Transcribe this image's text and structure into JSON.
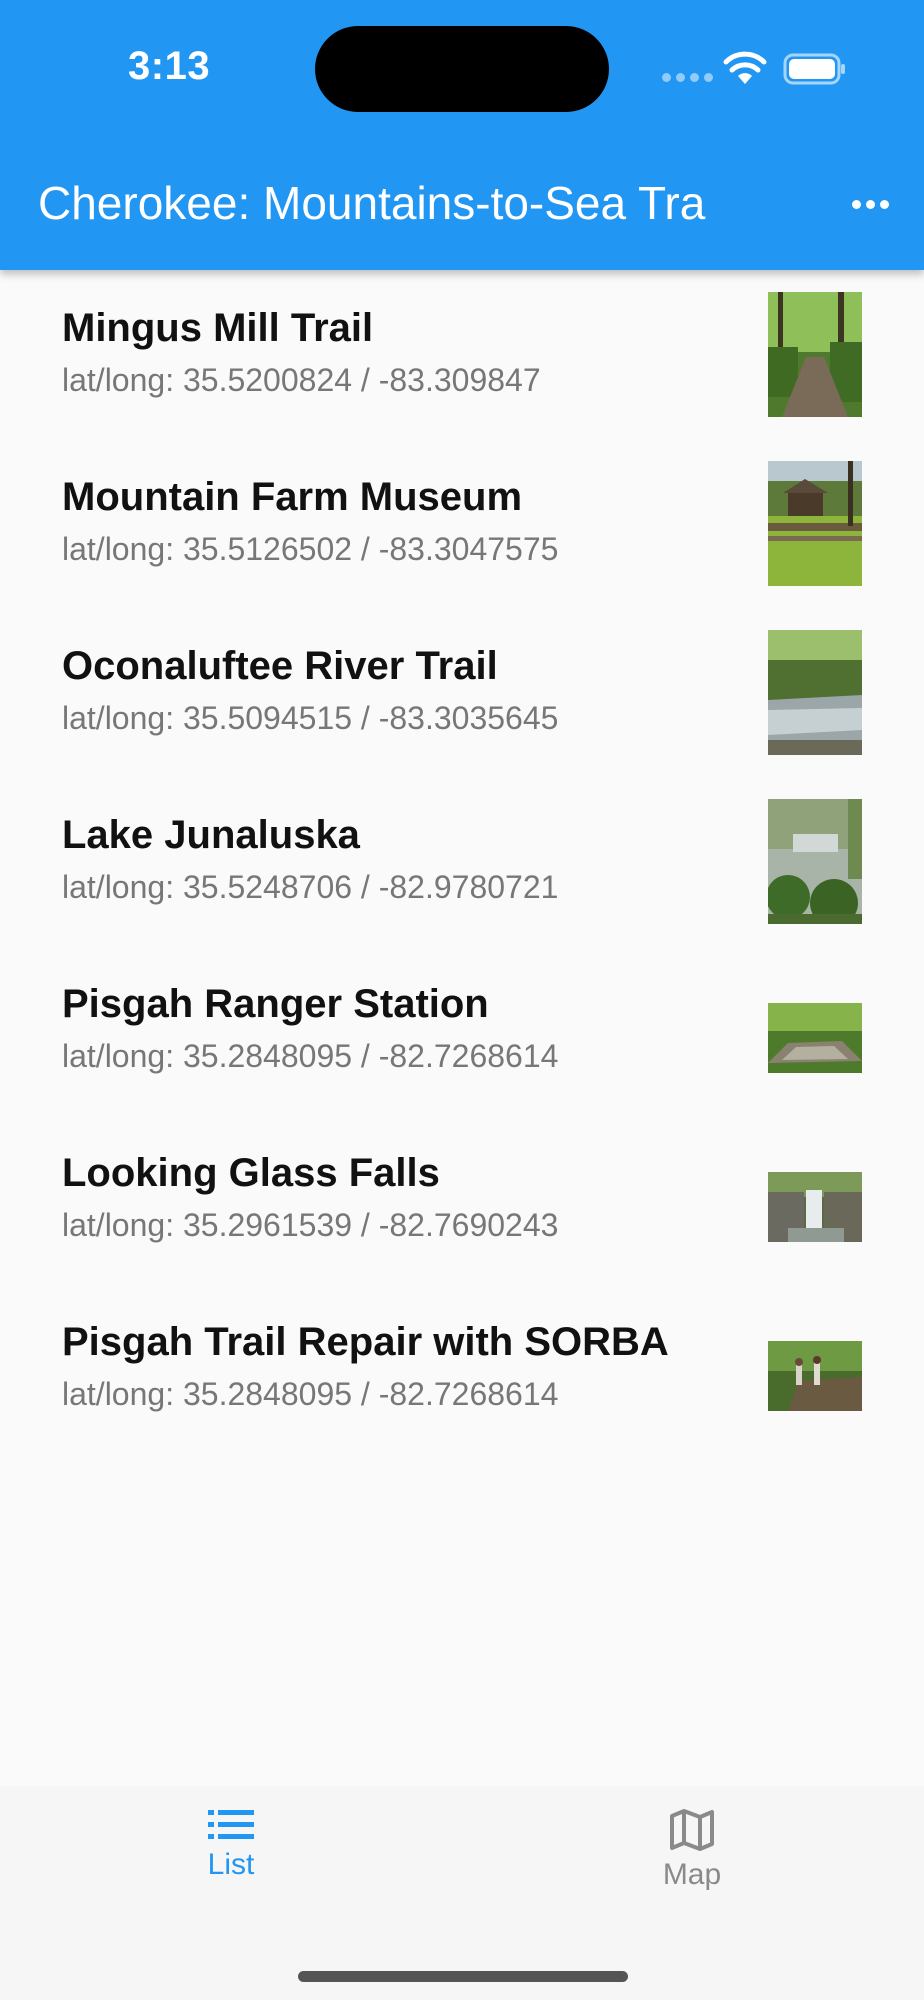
{
  "status_bar": {
    "time": "3:13"
  },
  "app_bar": {
    "title": "Cherokee: Mountains-to-Sea Tra"
  },
  "items": [
    {
      "title": "Mingus Mill Trail",
      "subtitle": "lat/long: 35.5200824 / -83.309847"
    },
    {
      "title": "Mountain Farm Museum",
      "subtitle": "lat/long: 35.5126502 / -83.3047575"
    },
    {
      "title": "Oconaluftee River Trail",
      "subtitle": "lat/long: 35.5094515 / -83.3035645"
    },
    {
      "title": "Lake Junaluska",
      "subtitle": "lat/long: 35.5248706 / -82.9780721"
    },
    {
      "title": "Pisgah Ranger Station",
      "subtitle": "lat/long: 35.2848095 / -82.7268614"
    },
    {
      "title": "Looking Glass Falls",
      "subtitle": "lat/long: 35.2961539 / -82.7690243"
    },
    {
      "title": "Pisgah Trail Repair with SORBA",
      "subtitle": "lat/long: 35.2848095 / -82.7268614"
    }
  ],
  "tabs": [
    {
      "label": "List",
      "icon": "list-icon",
      "active": true
    },
    {
      "label": "Map",
      "icon": "map-icon",
      "active": false
    }
  ],
  "colors": {
    "primary": "#2196f3",
    "inactive": "#8a8a8a",
    "background": "#fafafa"
  }
}
